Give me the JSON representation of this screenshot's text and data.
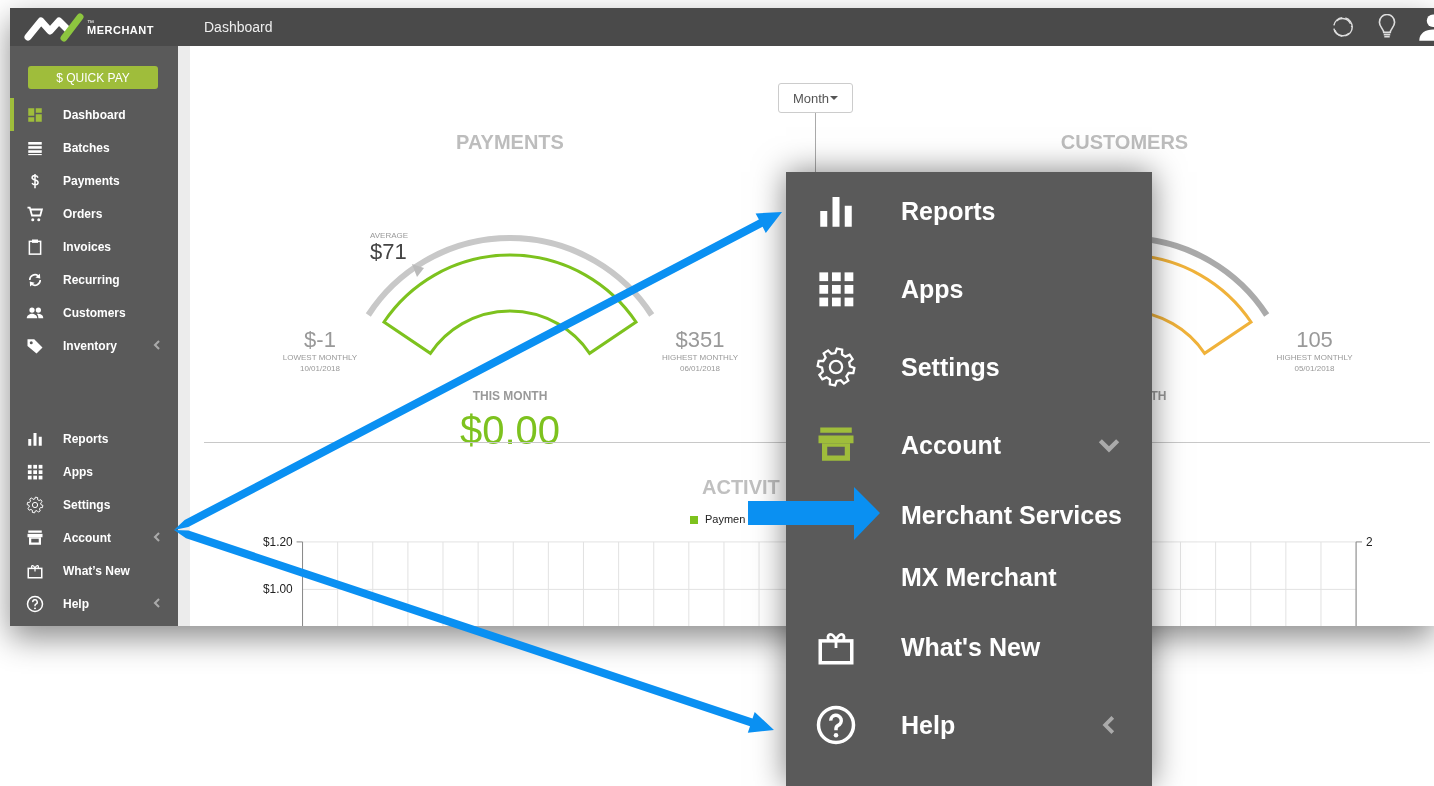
{
  "header": {
    "logo_text": "MERCHANT",
    "trademark": "™",
    "page_title": "Dashboard"
  },
  "sidebar": {
    "quick_pay": "$ QUICK PAY",
    "items": [
      {
        "label": "Dashboard",
        "kind": "link",
        "selected": true
      },
      {
        "label": "Batches",
        "kind": "link",
        "selected": false
      },
      {
        "label": "Payments",
        "kind": "link",
        "selected": false
      },
      {
        "label": "Orders",
        "kind": "link",
        "selected": false
      },
      {
        "label": "Invoices",
        "kind": "link",
        "selected": false
      },
      {
        "label": "Recurring",
        "kind": "link",
        "selected": false
      },
      {
        "label": "Customers",
        "kind": "link",
        "selected": false
      },
      {
        "label": "Inventory",
        "kind": "group",
        "selected": false,
        "expanded": false
      }
    ],
    "bottom_items": [
      {
        "label": "Reports",
        "kind": "link",
        "selected": false
      },
      {
        "label": "Apps",
        "kind": "link",
        "selected": false
      },
      {
        "label": "Settings",
        "kind": "link",
        "selected": false
      },
      {
        "label": "Account",
        "kind": "group",
        "selected": false,
        "expanded": false
      },
      {
        "label": "What’s New",
        "kind": "link",
        "selected": false
      },
      {
        "label": "Help",
        "kind": "group",
        "selected": false,
        "expanded": false
      }
    ]
  },
  "payments": {
    "title": "PAYMENTS",
    "average_label": "AVERAGE",
    "average": "$71",
    "lowest": {
      "value": "$-1",
      "label": "LOWEST MONTHLY",
      "date": "10/01/2018"
    },
    "highest": {
      "value": "$351",
      "label": "HIGHEST MONTHLY",
      "date": "06/01/2018"
    },
    "this_month_label": "THIS MONTH",
    "this_month": "$0.00"
  },
  "period_dropdown": {
    "value": "Month"
  },
  "customers": {
    "title": "CUSTOMERS",
    "highest": {
      "value": "105",
      "label": "HIGHEST MONTHLY",
      "date": "05/01/2018"
    },
    "this_month_label": "TH"
  },
  "activity": {
    "title": "ACTIVIT",
    "legend": [
      "Paymen"
    ],
    "left_ticks": [
      "$1.20",
      "$1.00"
    ],
    "right_ticks": [
      "2"
    ]
  },
  "menu_callout": {
    "items": [
      {
        "label": "Reports",
        "kind": "item"
      },
      {
        "label": "Apps",
        "kind": "item"
      },
      {
        "label": "Settings",
        "kind": "item"
      },
      {
        "label": "Account",
        "kind": "group",
        "expanded": true
      },
      {
        "label": "Merchant Services",
        "kind": "subitem"
      },
      {
        "label": "MX Merchant",
        "kind": "subitem"
      },
      {
        "label": "What's New",
        "kind": "item"
      },
      {
        "label": "Help",
        "kind": "group",
        "expanded": false
      }
    ]
  }
}
